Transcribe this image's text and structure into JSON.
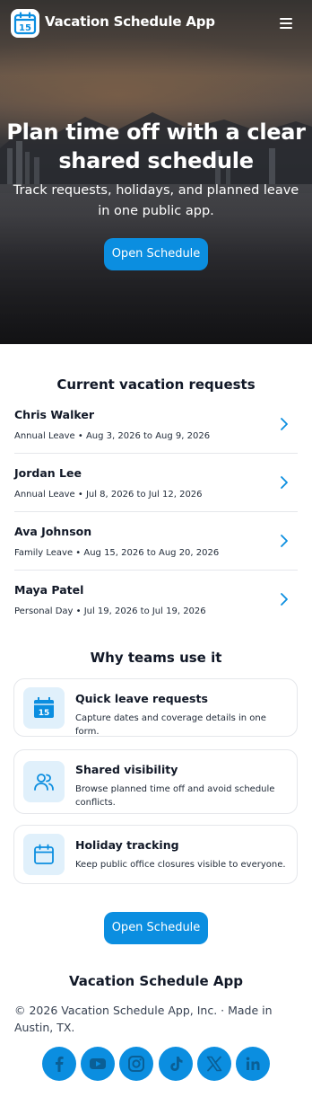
{
  "header": {
    "app_name": "Vacation Schedule App",
    "logo_day": "15",
    "menu_icon": "hamburger-menu-icon"
  },
  "hero": {
    "title": "Plan time off with a clear shared schedule",
    "subtitle": "Track requests, holidays, and planned leave in one public app.",
    "cta_label": "Open Schedule"
  },
  "requests": {
    "heading": "Current vacation requests",
    "items": [
      {
        "name": "Chris Walker",
        "detail": "Annual Leave • Aug 3, 2026 to Aug 9, 2026"
      },
      {
        "name": "Jordan Lee",
        "detail": "Annual Leave • Jul 8, 2026 to Jul 12, 2026"
      },
      {
        "name": "Ava Johnson",
        "detail": "Family Leave • Aug 15, 2026 to Aug 20, 2026"
      },
      {
        "name": "Maya Patel",
        "detail": "Personal Day • Jul 19, 2026 to Jul 19, 2026"
      }
    ]
  },
  "features": {
    "heading": "Why teams use it",
    "items": [
      {
        "title": "Quick leave requests",
        "text": "Capture dates and coverage details in one form.",
        "icon": "calendar-15-icon",
        "icon_day": "15"
      },
      {
        "title": "Shared visibility",
        "text": "Browse planned time off and avoid schedule conflicts.",
        "icon": "users-icon"
      },
      {
        "title": "Holiday tracking",
        "text": "Keep public office closures visible to everyone.",
        "icon": "calendar-icon"
      }
    ]
  },
  "bottom_cta": {
    "label": "Open Schedule"
  },
  "footer": {
    "title": "Vacation Schedule App",
    "copyright": "© 2026 Vacation Schedule App, Inc. · Made in Austin, TX.",
    "social": [
      "facebook-icon",
      "youtube-icon",
      "instagram-icon",
      "tiktok-icon",
      "x-icon",
      "linkedin-icon"
    ]
  },
  "colors": {
    "accent": "#0b8ee0",
    "accent_light": "#e0f0fb",
    "text": "#111827",
    "divider": "#e5e7eb"
  }
}
